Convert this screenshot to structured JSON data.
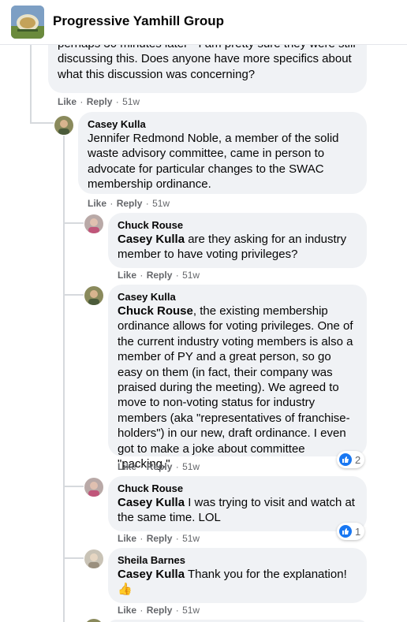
{
  "header": {
    "group_name": "Progressive Yamhill Group"
  },
  "actions": {
    "like": "Like",
    "reply": "Reply",
    "sep": "·"
  },
  "comments": [
    {
      "author": "",
      "text": "perhaps 30 minutes later - I am pretty sure they were still discussing this. Does anyone have more specifics about what this discussion was concerning?",
      "time": "51w"
    },
    {
      "author": "Casey Kulla",
      "text": "Jennifer Redmond Noble, a member of the solid waste advisory committee, came in person to advocate for particular changes to the SWAC membership ordinance.",
      "time": "51w"
    },
    {
      "author": "Chuck Rouse",
      "mention": "Casey Kulla",
      "text": " are they asking for an industry member to have voting privileges?",
      "time": "51w"
    },
    {
      "author": "Casey Kulla",
      "mention": "Chuck Rouse",
      "text": ", the existing membership ordinance allows for voting privileges. One of the current industry voting members is also a member of PY and a great person, so go easy on them (in fact, their company was praised during the meeting). We agreed to move to non-voting status for industry members (aka \"representatives of franchise-holders\") in our new, draft ordinance. I even got to make a joke about committee \"packing.\"",
      "time": "51w",
      "reactions": "2"
    },
    {
      "author": "Chuck Rouse",
      "mention": "Casey Kulla",
      "text": " I was trying to visit and watch at the same time. LOL",
      "time": "51w",
      "reactions": "1"
    },
    {
      "author": "Sheila Barnes",
      "mention": "Casey Kulla",
      "text": " Thank you for the explanation!",
      "emoji": "👍",
      "time": "51w"
    }
  ],
  "icons": {
    "group_logo": "group-logo-icon",
    "like_reaction": "thumbs-up-icon"
  },
  "colors": {
    "bubble": "#f0f2f5",
    "secondary_text": "#65676b",
    "like_blue": "#1877f2"
  }
}
